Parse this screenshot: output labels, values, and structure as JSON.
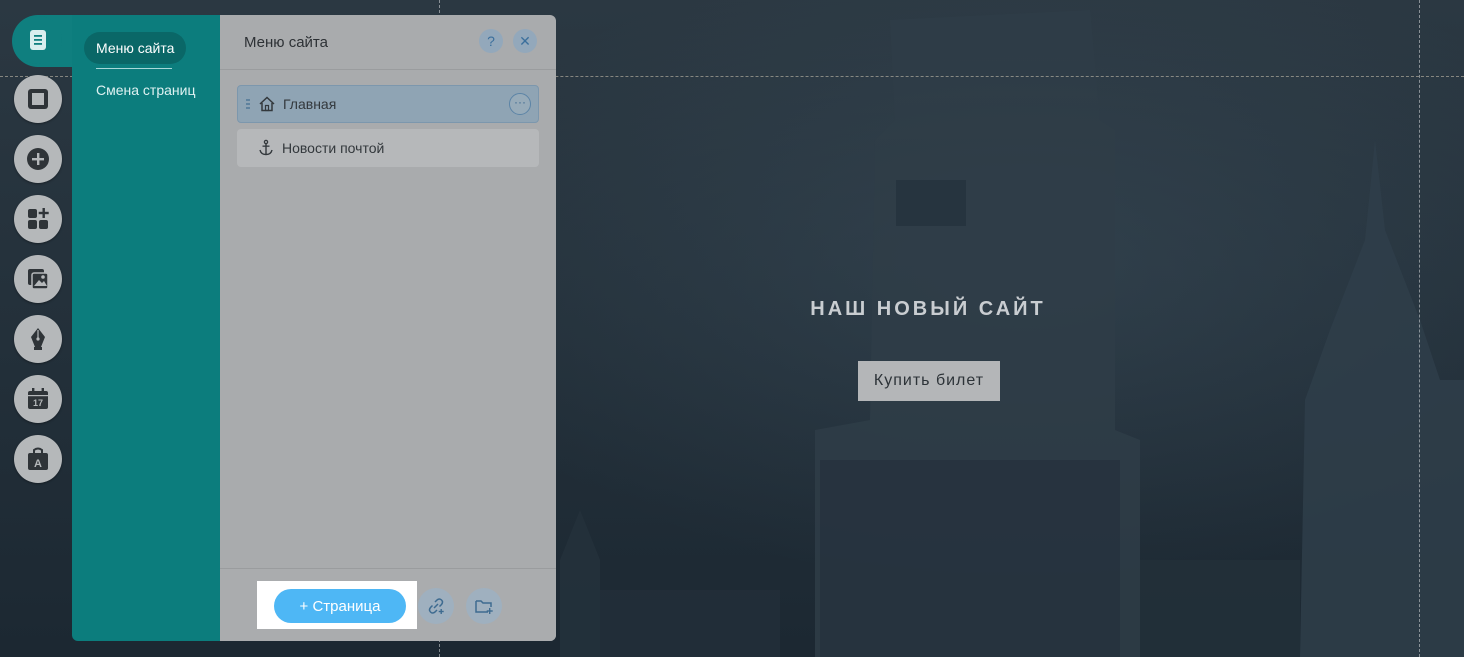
{
  "hero": {
    "title": "НАШ НОВЫЙ САЙТ",
    "button_label": "Купить билет"
  },
  "toolbar": {
    "tools": [
      {
        "icon": "pages-icon",
        "active": true
      },
      {
        "icon": "background-icon"
      },
      {
        "icon": "add-icon"
      },
      {
        "icon": "apps-icon"
      },
      {
        "icon": "media-icon"
      },
      {
        "icon": "blog-icon"
      },
      {
        "icon": "bookings-icon"
      },
      {
        "icon": "store-icon"
      }
    ]
  },
  "submenu": {
    "items": [
      {
        "label": "Меню сайта",
        "selected": true
      },
      {
        "label": "Смена страниц"
      }
    ]
  },
  "panel": {
    "title": "Меню сайта",
    "help_label": "?",
    "close_label": "✕",
    "pages": [
      {
        "label": "Главная",
        "icon": "home-icon",
        "selected": true
      },
      {
        "label": "Новости почтой",
        "icon": "anchor-icon"
      }
    ],
    "more_label": "···",
    "add_page_label": "+ Страница"
  },
  "colors": {
    "accent_teal": "#0c7d7d",
    "button_blue": "#4eb7f5"
  }
}
